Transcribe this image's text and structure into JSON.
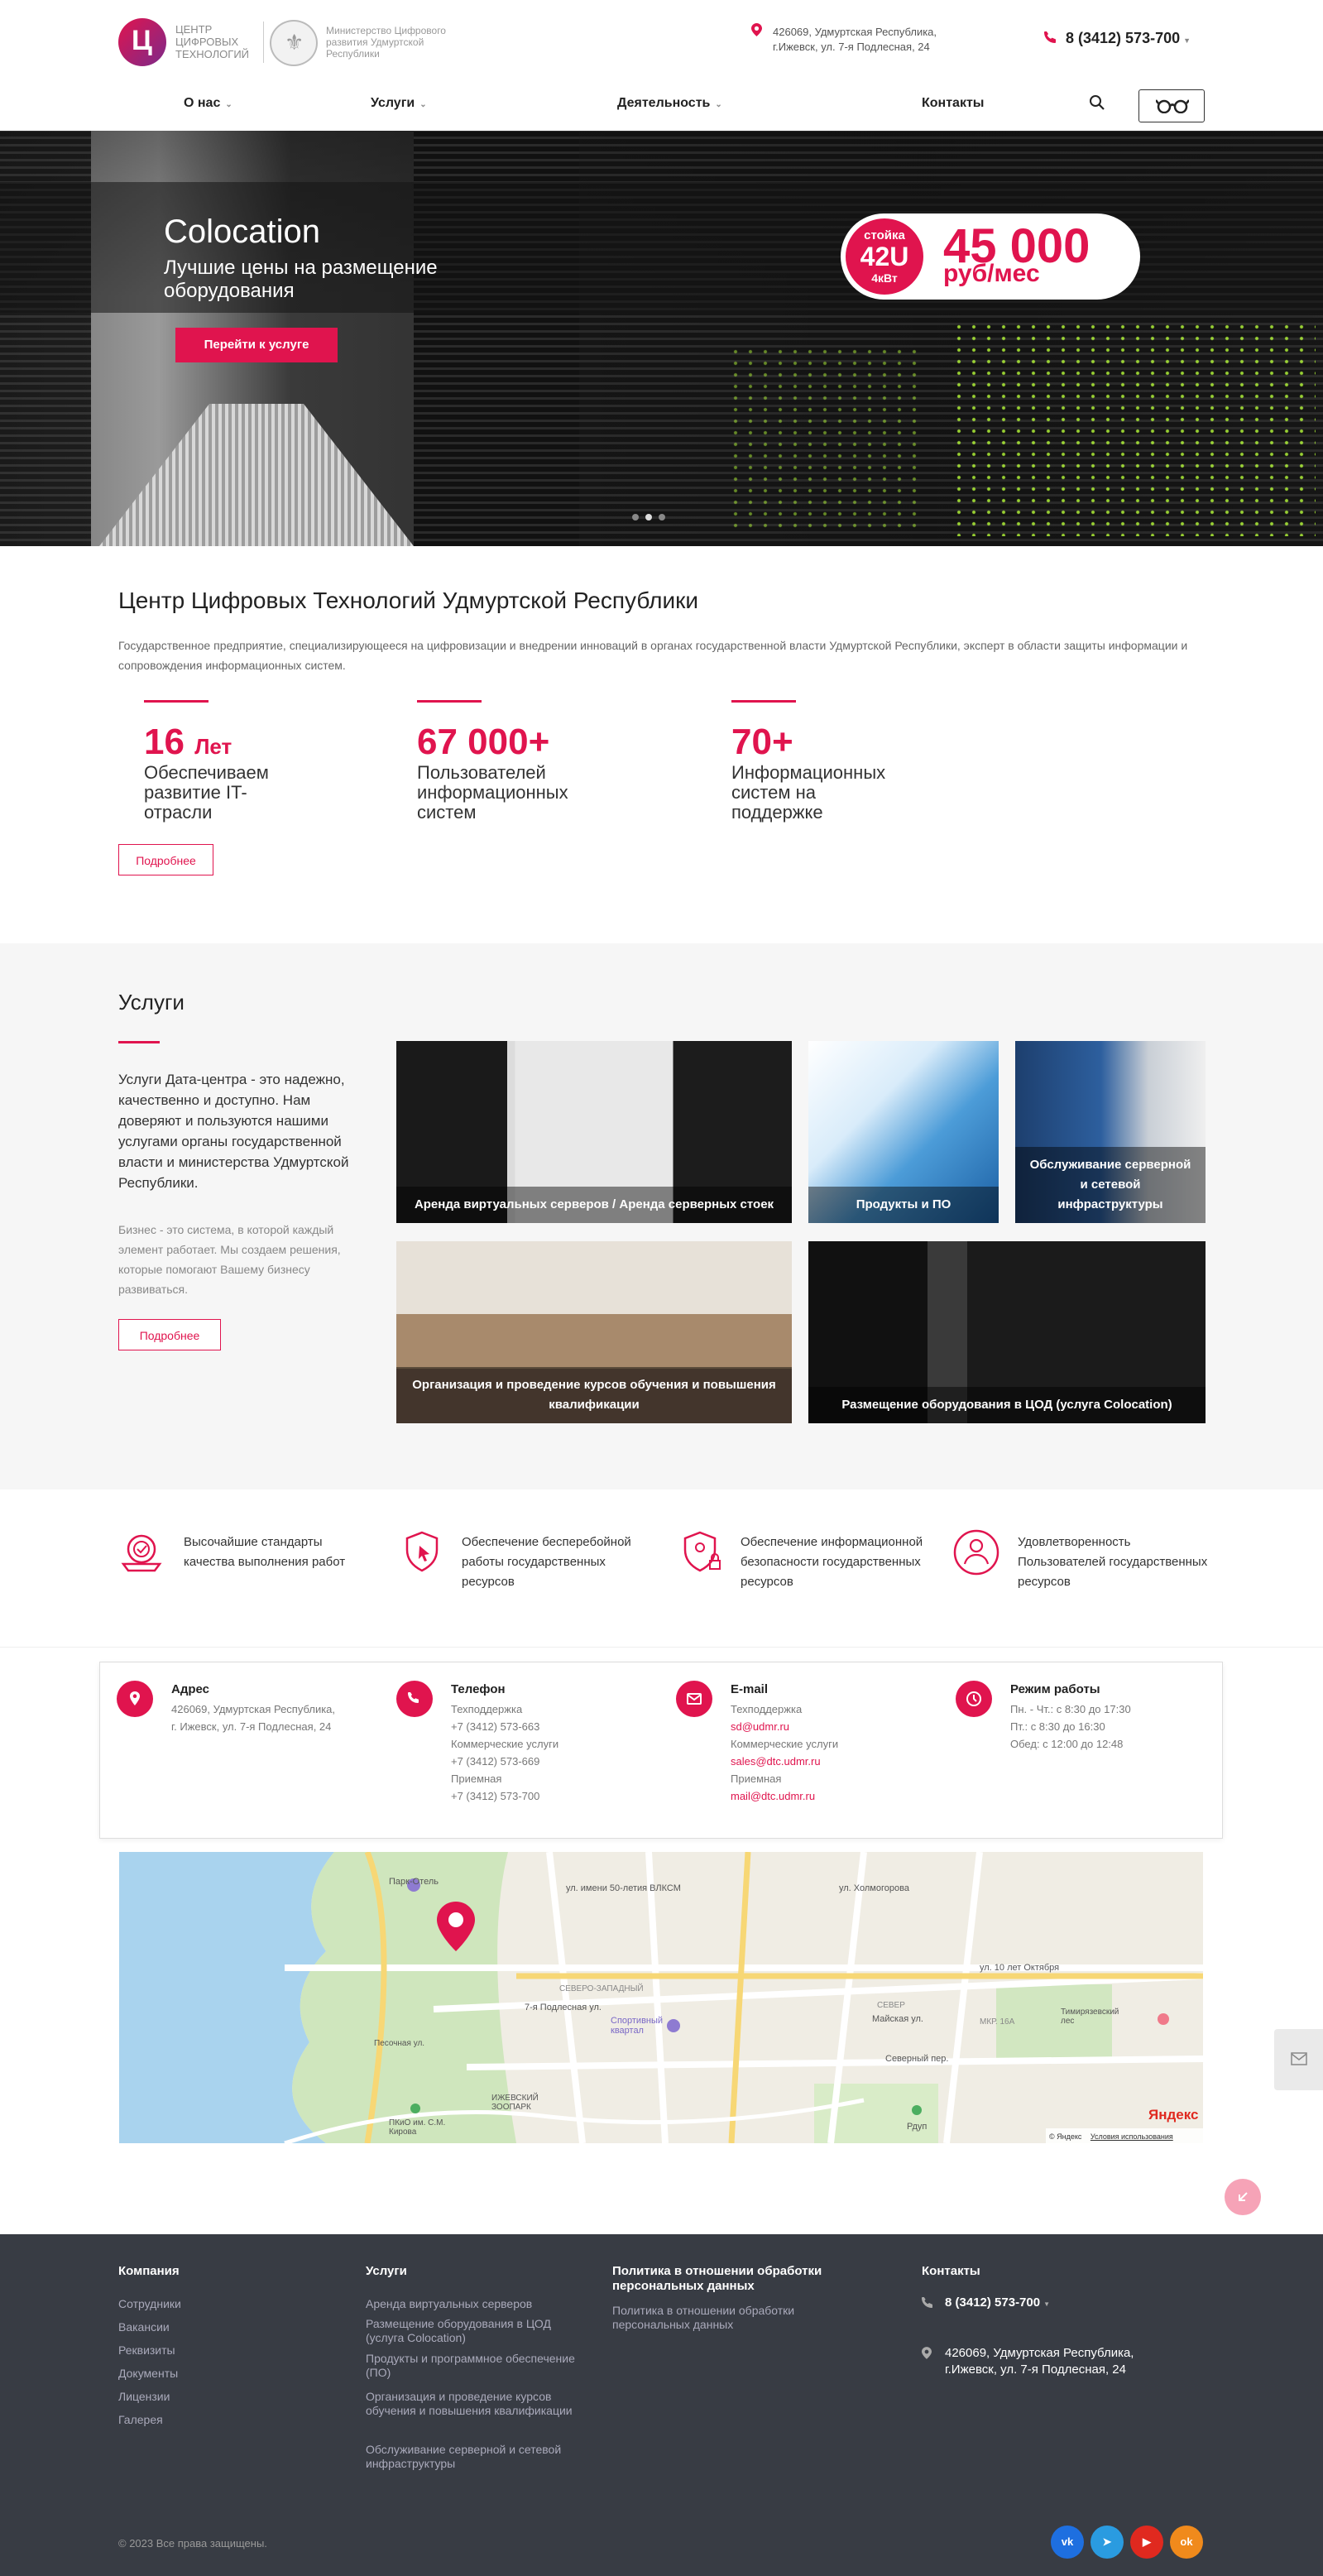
{
  "header": {
    "logo_text": "Центр цифровых технологий",
    "ministry_text": "Министерство Цифрового развития Удмуртской Республики",
    "address": "426069, Удмуртская Республика, г.Ижевск, ул. 7-я Подлесная, 24",
    "phone": "8 (3412) 573-700"
  },
  "nav": [
    {
      "label": "О нас",
      "has_dropdown": true
    },
    {
      "label": "Услуги",
      "has_dropdown": true
    },
    {
      "label": "Деятельность",
      "has_dropdown": true
    },
    {
      "label": "Контакты",
      "has_dropdown": false
    }
  ],
  "hero": {
    "title": "Colocation",
    "subtitle": "Лучшие цены на размещение оборудования",
    "button": "Перейти к услуге",
    "badge_line1": "стойка",
    "badge_line2": "42U",
    "badge_line3": "4кВт",
    "price": "45 000",
    "price_unit": "руб/мес",
    "slides_total": 3,
    "slide_active": 1
  },
  "about": {
    "title": "Центр Цифровых Технологий Удмуртской Республики",
    "text": "Государственное предприятие, специализирующееся на цифровизации и внедрении инноваций в органах государственной власти Удмуртской Республики, эксперт в области защиты информации и сопровождения информационных систем.",
    "stats": [
      {
        "number": "16",
        "unit": "Лет",
        "desc": "Обеспечиваем развитие IT-отрасли"
      },
      {
        "number": "67 000+",
        "unit": "",
        "desc": "Пользователей информационных систем"
      },
      {
        "number": "70+",
        "unit": "",
        "desc": "Информационных систем на поддержке"
      }
    ],
    "more": "Подробнее"
  },
  "services": {
    "title": "Услуги",
    "text": "Услуги Дата-центра - это надежно, качественно и доступно. Нам доверяют и пользуются нашими услугами органы государственной власти и министерства Удмуртской Республики.",
    "sub": "Бизнес - это система, в которой каждый элемент работает. Мы создаем решения, которые помогают Вашему бизнесу развиваться.",
    "more": "Подробнее",
    "tiles": [
      "Аренда виртуальных серверов / Аренда серверных стоек",
      "Продукты и ПО",
      "Обслуживание серверной и сетевой инфраструктуры",
      "Организация и проведение курсов обучения и повышения квалификации",
      "Размещение оборудования в ЦОД (услуга Colocation)"
    ]
  },
  "features": [
    "Высочайшие стандарты качества выполнения работ",
    "Обеспечение бесперебойной работы государственных ресурсов",
    "Обеспечение информационной безопасности государственных ресурсов",
    "Удовлетворенность Пользователей государственных ресурсов"
  ],
  "contacts": {
    "address": {
      "head": "Адрес",
      "lines": [
        "426069, Удмуртская Республика,",
        "г. Ижевск, ул. 7-я Подлесная, 24"
      ]
    },
    "phone": {
      "head": "Телефон",
      "lines": [
        "Техподдержка",
        "+7 (3412) 573-663",
        "Коммерческие услуги",
        "+7 (3412) 573-669",
        "Приемная",
        "+7 (3412) 573-700"
      ]
    },
    "email": {
      "head": "E-mail",
      "lines": [
        "Техподдержка",
        "sd@udmr.ru",
        "Коммерческие услуги",
        "sales@dtc.udmr.ru",
        "Приемная",
        "mail@dtc.udmr.ru"
      ]
    },
    "hours": {
      "head": "Режим работы",
      "lines": [
        "Пн. - Чт.: с 8:30 до 17:30",
        "Пт.: с 8:30 до 16:30",
        "Обед: с 12:00 до 12:48"
      ]
    }
  },
  "map": {
    "labels": [
      "Парк-Отель",
      "ул. имени 50-летия ВЛКСМ",
      "ул. Холмогорова",
      "ул. 10 лет Октября",
      "7-я Подлесная ул.",
      "Спортивный квартал",
      "СЕВЕРО-ЗАПАДНЫЙ",
      "ИЖЕВСКИЙ ЗООПАРК",
      "ПКиО им. С.М. Кирова",
      "Тимирязевский лес",
      "СЕВЕР",
      "Майская ул.",
      "Северный пер.",
      "Рдуп",
      "Песочная ул.",
      "МКР. 16А"
    ],
    "copyright": "© Яндекс",
    "terms": "Условия использования",
    "brand": "Яндекс"
  },
  "footer": {
    "company": {
      "head": "Компания",
      "links": [
        "Сотрудники",
        "Вакансии",
        "Реквизиты",
        "Документы",
        "Лицензии",
        "Галерея"
      ]
    },
    "services": {
      "head": "Услуги",
      "links": [
        "Аренда виртуальных серверов",
        "Размещение оборудования в ЦОД (услуга Colocation)",
        "Продукты и программное обеспечение (ПО)",
        "Организация и проведение курсов обучения и повышения квалификации",
        "Обслуживание серверной и сетевой инфраструктуры"
      ]
    },
    "policy": {
      "head": "Политика в отношении обработки персональных данных",
      "link": "Политика в отношении обработки персональных данных"
    },
    "contacts": {
      "head": "Контакты",
      "phone": "8 (3412) 573-700",
      "address": "426069, Удмуртская Республика, г.Ижевск, ул. 7-я Подлесная, 24"
    },
    "copyright": "© 2023 Все права защищены.",
    "social": [
      {
        "name": "vk",
        "label": "vk",
        "color": "#1e6fe0"
      },
      {
        "name": "telegram",
        "label": "➤",
        "color": "#2a9be0"
      },
      {
        "name": "youtube",
        "label": "▶",
        "color": "#e0291f"
      },
      {
        "name": "odnoklassniki",
        "label": "ok",
        "color": "#f08a1c"
      }
    ]
  },
  "colors": {
    "accent": "#e0144e",
    "footer_bg": "#383c44",
    "services_bg": "#f6f6f6"
  }
}
